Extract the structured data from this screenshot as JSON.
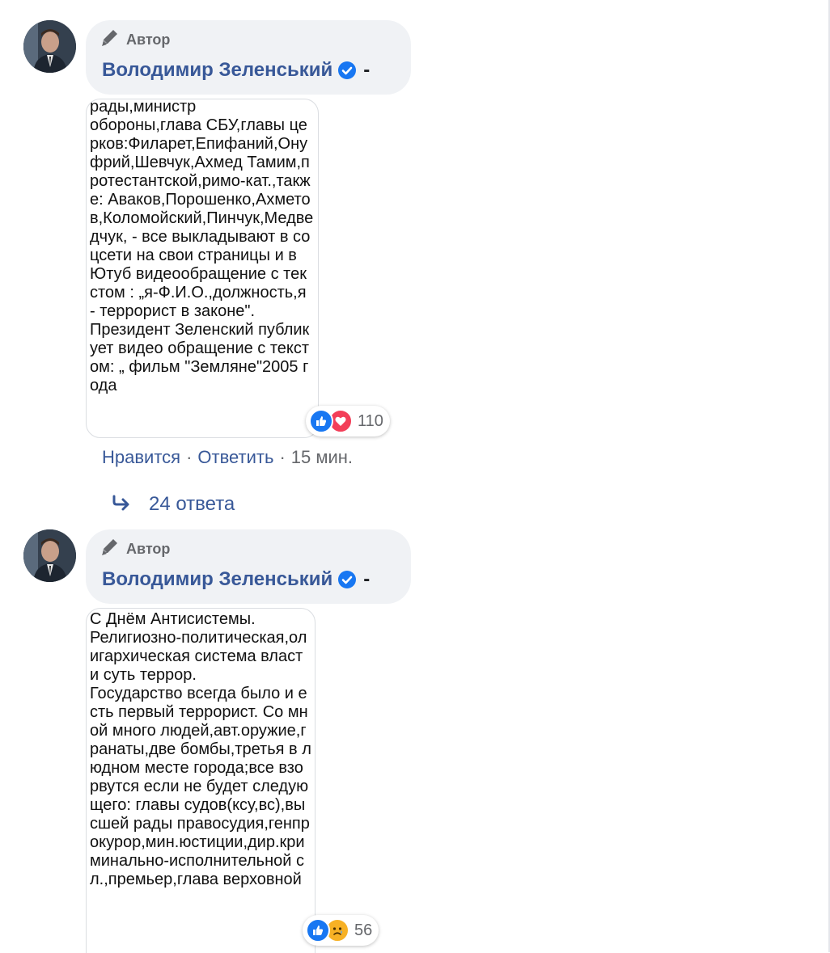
{
  "comments": [
    {
      "author_label": "Автор",
      "author_name": "Володимир Зеленський",
      "separator": "-",
      "card_text": "рады,министр\nобороны,глава СБУ,главы церков:Филарет,Епифаний,Онуфрий,Шевчук,Ахмед Тамим,протестантской,римо-кат.,также: Аваков,Порошенко,Ахметов,Коломойский,Пинчук,Медведчук, - все выкладывают в соцсети на свои страницы и в Ютуб видеообращение с текстом : „я-Ф.И.О.,должность,я - террорист в законе\".\nПрезидент Зеленский публикует видео обращение с текстом: „ фильм \"Земляне\"2005 года",
      "reaction_count": "110",
      "reactions": [
        "like",
        "love"
      ],
      "actions": {
        "like": "Нравится",
        "reply": "Ответить",
        "time": "15 мин."
      },
      "replies_label": "24 ответа"
    },
    {
      "author_label": "Автор",
      "author_name": "Володимир Зеленський",
      "separator": "-",
      "card_text": "С Днём Антисистемы.\nРелигиозно-политическая,олигархическая система власти суть террор.\nГосударство всегда было и есть первый террорист. Со мной много людей,авт.оружие,гранаты,две бомбы,третья в людном месте города;все взорвутся если не будет следующего: главы судов(ксу,вс),высшей рады правосудия,генпрокурор,мин.юстиции,дир.криминально-исполнительной сл.,премьер,глава верховной",
      "reaction_count": "56",
      "reactions": [
        "like",
        "sad"
      ]
    }
  ],
  "icons": {
    "author": "pencil-icon",
    "verified": "verified-badge-icon",
    "reply_arrow": "reply-arrow-icon"
  },
  "colors": {
    "link": "#385898",
    "bubble": "#f0f2f5",
    "like": "#1877f2",
    "love": "#f33e58",
    "sad": "#f7b125"
  }
}
